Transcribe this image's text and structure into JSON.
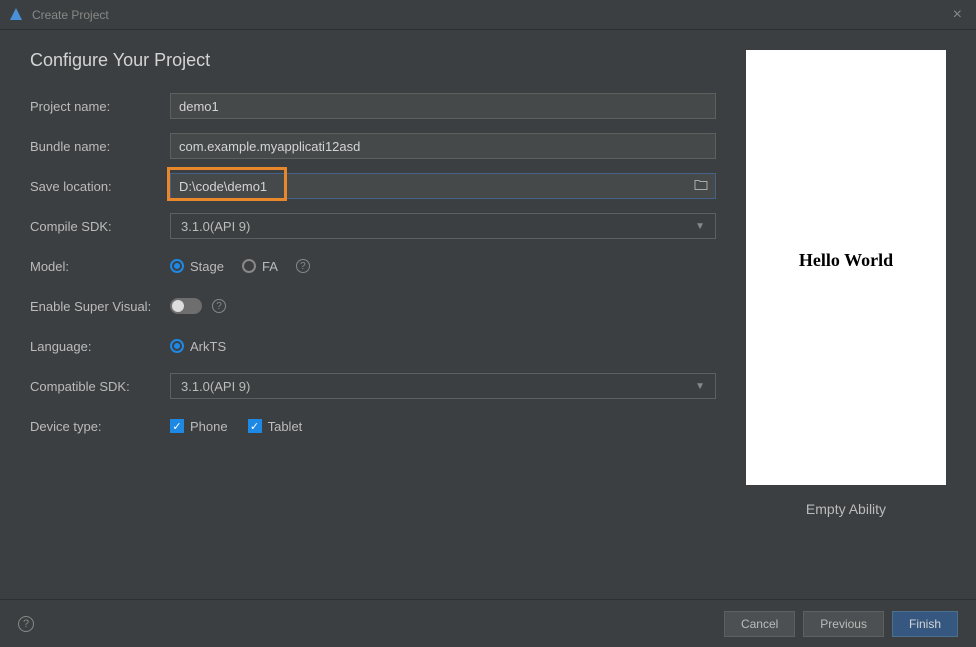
{
  "titlebar": {
    "title": "Create Project"
  },
  "heading": "Configure Your Project",
  "form": {
    "project_name": {
      "label": "Project name:",
      "value": "demo1"
    },
    "bundle_name": {
      "label": "Bundle name:",
      "value": "com.example.myapplicati12asd"
    },
    "save_location": {
      "label": "Save location:",
      "value": "D:\\code\\demo1"
    },
    "compile_sdk": {
      "label": "Compile SDK:",
      "value": "3.1.0(API 9)"
    },
    "model": {
      "label": "Model:",
      "options": [
        {
          "label": "Stage",
          "selected": true
        },
        {
          "label": "FA",
          "selected": false
        }
      ]
    },
    "enable_super_visual": {
      "label": "Enable Super Visual:",
      "value": false
    },
    "language": {
      "label": "Language:",
      "options": [
        {
          "label": "ArkTS",
          "selected": true
        }
      ]
    },
    "compatible_sdk": {
      "label": "Compatible SDK:",
      "value": "3.1.0(API 9)"
    },
    "device_type": {
      "label": "Device type:",
      "options": [
        {
          "label": "Phone",
          "checked": true
        },
        {
          "label": "Tablet",
          "checked": true
        }
      ]
    }
  },
  "preview": {
    "content_text": "Hello World",
    "caption": "Empty Ability"
  },
  "footer": {
    "cancel": "Cancel",
    "previous": "Previous",
    "finish": "Finish"
  },
  "colors": {
    "accent": "#1e88e5",
    "highlight": "#e8872b",
    "primary_btn": "#365880"
  }
}
